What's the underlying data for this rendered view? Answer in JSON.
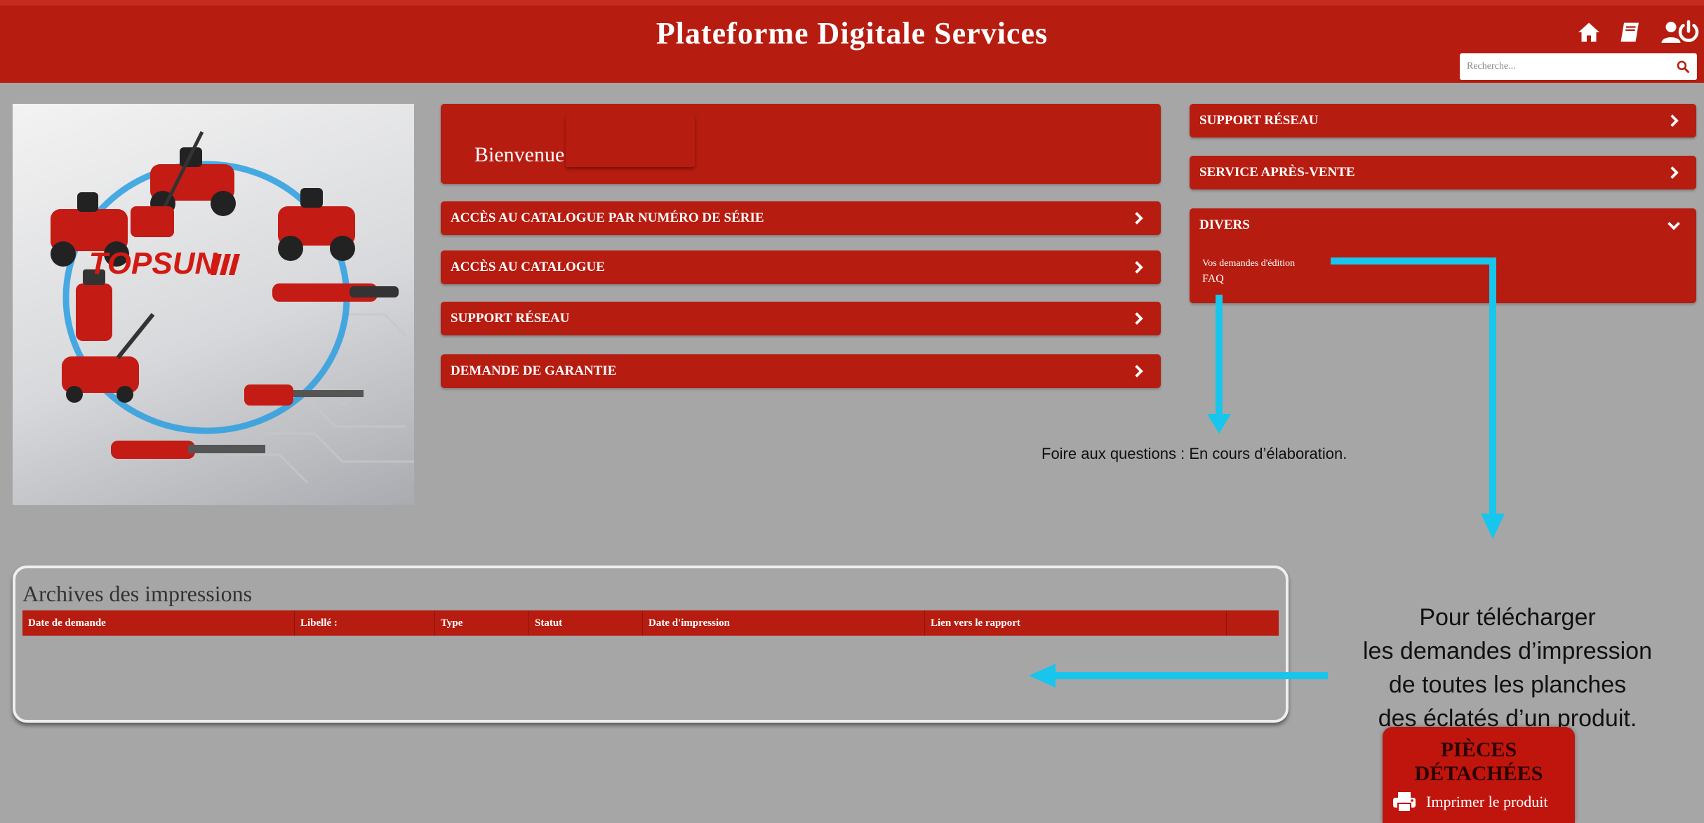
{
  "header": {
    "title": "Plateforme Digitale Services",
    "icons": [
      "home-icon",
      "book-icon",
      "user-icon",
      "power-icon"
    ],
    "search_placeholder": "Recherche..."
  },
  "hero": {
    "brand": "TOPSUN"
  },
  "welcome": {
    "text": "Bienvenue"
  },
  "center_menu": [
    {
      "label": "ACCÈS AU CATALOGUE PAR NUMÉRO DE SÉRIE"
    },
    {
      "label": "ACCÈS AU CATALOGUE"
    },
    {
      "label": "SUPPORT RÉSEAU"
    },
    {
      "label": "DEMANDE DE GARANTIE"
    }
  ],
  "right_menu": [
    {
      "label": "SUPPORT RÉSEAU"
    },
    {
      "label": "SERVICE APRÈS-VENTE"
    },
    {
      "label": "DIVERS"
    }
  ],
  "divers_links": [
    "Vos demandes d'édition",
    "FAQ"
  ],
  "archives": {
    "title": "Archives des impressions",
    "columns": [
      "Date de demande",
      "Libellé :",
      "Type",
      "Statut",
      "Date d'impression",
      "Lien vers le rapport",
      ""
    ]
  },
  "annotations": {
    "faq_note": "Foire aux questions : En cours d’élaboration.",
    "download_note_lines": [
      "Pour télécharger",
      "les demandes d’impression",
      "de toutes les planches",
      "des éclatés d’un produit."
    ]
  },
  "pieces": {
    "title": "PIÈCES DÉTACHÉES",
    "print_label": "Imprimer le produit"
  },
  "colors": {
    "brand_red": "#b71c10",
    "background": "#a6a6a6",
    "annotation_cyan": "#18c5ec"
  }
}
